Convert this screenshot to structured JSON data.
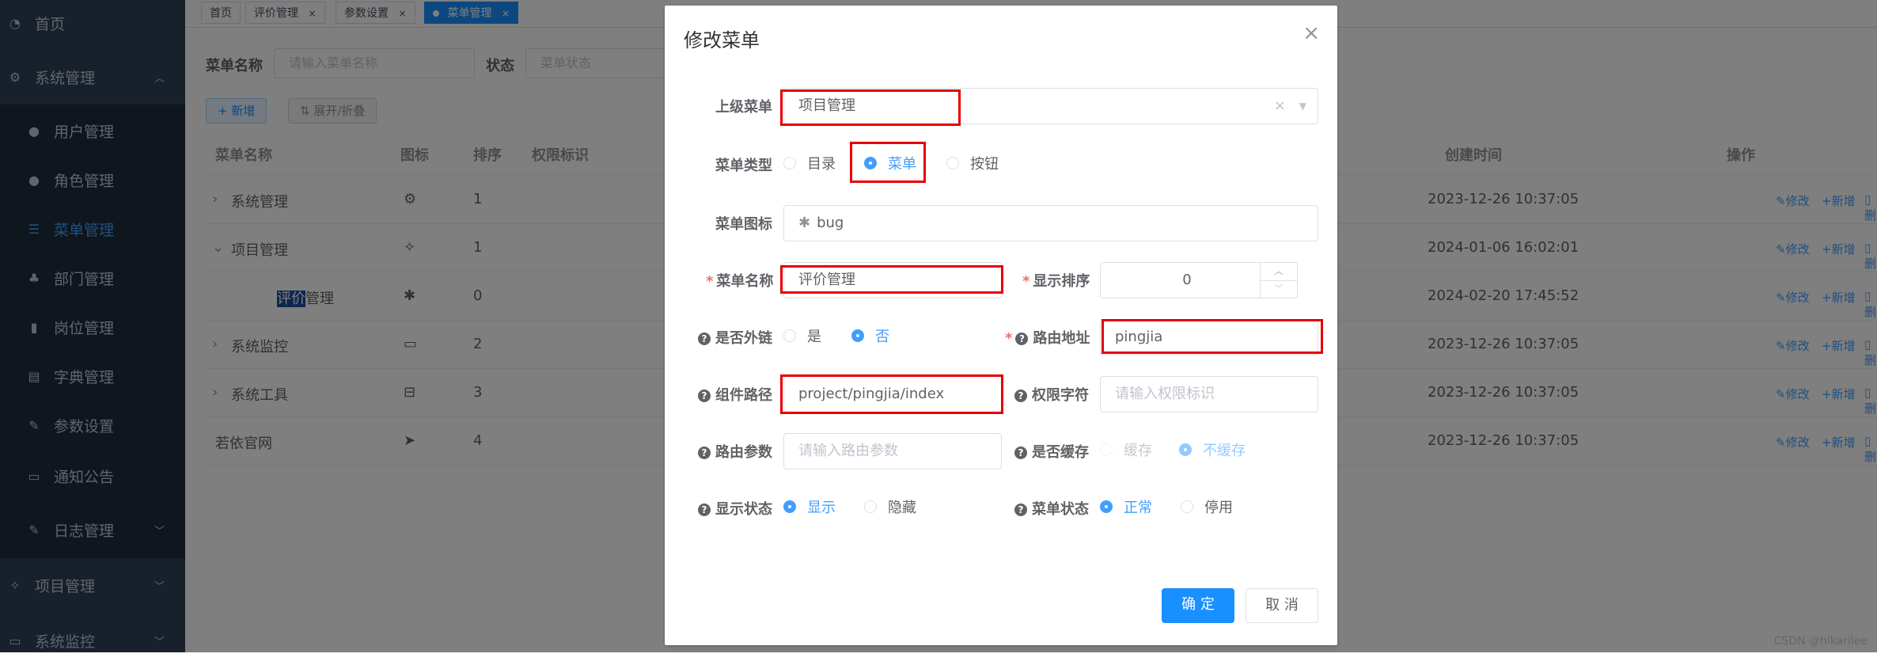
{
  "sidebar": {
    "items": [
      {
        "label": "首页",
        "icon": "dashboard-icon"
      },
      {
        "label": "系统管理",
        "icon": "gear-icon"
      },
      {
        "label": "用户管理",
        "icon": "user-icon"
      },
      {
        "label": "角色管理",
        "icon": "peoples-icon"
      },
      {
        "label": "菜单管理",
        "icon": "tree-table-icon"
      },
      {
        "label": "部门管理",
        "icon": "tree-icon"
      },
      {
        "label": "岗位管理",
        "icon": "post-icon"
      },
      {
        "label": "字典管理",
        "icon": "dict-icon"
      },
      {
        "label": "参数设置",
        "icon": "edit-icon"
      },
      {
        "label": "通知公告",
        "icon": "message-icon"
      },
      {
        "label": "日志管理",
        "icon": "log-icon"
      },
      {
        "label": "项目管理",
        "icon": "project-icon"
      },
      {
        "label": "系统监控",
        "icon": "monitor-icon"
      }
    ]
  },
  "tags": [
    {
      "label": "首页"
    },
    {
      "label": "评价管理",
      "close": "×"
    },
    {
      "label": "参数设置",
      "close": "×"
    },
    {
      "label": "菜单管理",
      "close": "×"
    }
  ],
  "search": {
    "name_label": "菜单名称",
    "name_placeholder": "请输入菜单名称",
    "status_label": "状态",
    "status_placeholder": "菜单状态"
  },
  "toolbar": {
    "add_label": "新增",
    "expand_label": "展开/折叠"
  },
  "table": {
    "headers": {
      "name": "菜单名称",
      "icon": "图标",
      "order": "排序",
      "perms": "权限标识",
      "created": "创建时间",
      "ops": "操作"
    },
    "rows": [
      {
        "name": "系统管理",
        "order": "1",
        "created": "2023-12-26 10:37:05",
        "icon": "gear-icon"
      },
      {
        "name": "项目管理",
        "order": "1",
        "created": "2024-01-06 16:02:01",
        "icon": "project-icon"
      },
      {
        "name_highlight": "评价",
        "name_rest": "管理",
        "order": "0",
        "created": "2024-02-20 17:45:52",
        "icon": "bug-icon"
      },
      {
        "name": "系统监控",
        "order": "2",
        "created": "2023-12-26 10:37:05",
        "icon": "monitor-icon"
      },
      {
        "name": "系统工具",
        "order": "3",
        "created": "2023-12-26 10:37:05",
        "icon": "tool-icon"
      },
      {
        "name": "若依官网",
        "order": "4",
        "created": "2023-12-26 10:37:05",
        "icon": "guide-icon"
      }
    ],
    "op_edit": "修改",
    "op_add": "新增",
    "op_delete": "删"
  },
  "dialog": {
    "title": "修改菜单",
    "close": "×",
    "parent_label": "上级菜单",
    "parent_value": "项目管理",
    "parent_clear": "×",
    "type_label": "菜单类型",
    "type_options": [
      "目录",
      "菜单",
      "按钮"
    ],
    "icon_label": "菜单图标",
    "icon_value": "bug",
    "name_label": "菜单名称",
    "name_value": "评价管理",
    "order_label": "显示排序",
    "order_value": "0",
    "external_label": "是否外链",
    "external_options": [
      "是",
      "否"
    ],
    "route_label": "路由地址",
    "route_value": "pingjia",
    "component_label": "组件路径",
    "component_value": "project/pingjia/index",
    "perms_label": "权限字符",
    "perms_placeholder": "请输入权限标识",
    "query_label": "路由参数",
    "query_placeholder": "请输入路由参数",
    "cache_label": "是否缓存",
    "cache_options": [
      "缓存",
      "不缓存"
    ],
    "visible_label": "显示状态",
    "visible_options": [
      "显示",
      "隐藏"
    ],
    "status_label": "菜单状态",
    "status_options": [
      "正常",
      "停用"
    ],
    "confirm": "确 定",
    "cancel": "取 消"
  },
  "watermark": "CSDN @hikarilee",
  "colors": {
    "primary": "#1890ff",
    "sidebar": "#304156",
    "annotation": "#e60000"
  }
}
